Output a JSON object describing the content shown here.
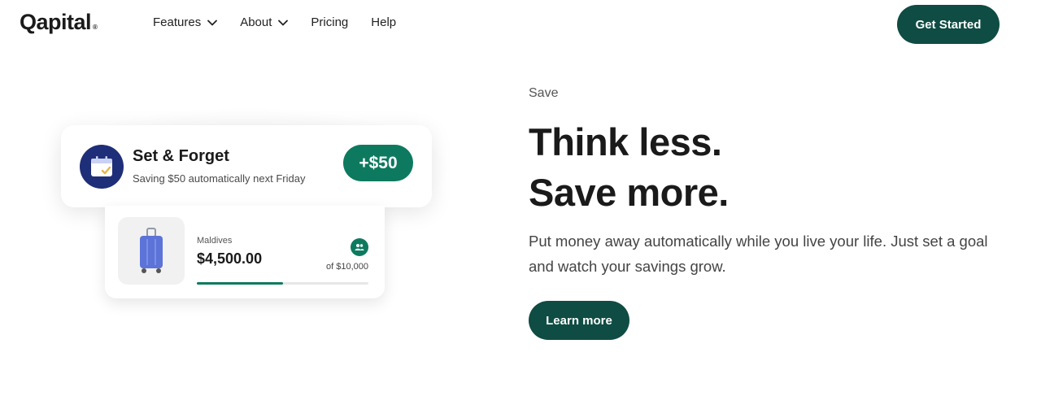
{
  "brand": {
    "name": "Qapital",
    "mark": "®",
    "accent": "#0f4c43",
    "green": "#0d7a5f"
  },
  "nav": {
    "items": [
      {
        "label": "Features",
        "dropdown": true
      },
      {
        "label": "About",
        "dropdown": true
      },
      {
        "label": "Pricing",
        "dropdown": false
      },
      {
        "label": "Help",
        "dropdown": false
      }
    ],
    "cta_label": "Get Started"
  },
  "illustration": {
    "rule_card": {
      "icon": "calendar-icon",
      "title": "Set & Forget",
      "subtitle": "Saving $50 automatically next Friday",
      "amount": "+$50"
    },
    "goal_card": {
      "icon": "suitcase-icon",
      "name": "Maldives",
      "amount": "$4,500.00",
      "target": "of $10,000",
      "progress": 0.5,
      "shared_icon": "people-icon"
    }
  },
  "hero": {
    "eyebrow": "Save",
    "headline_line1": "Think less.",
    "headline_line2": "Save more.",
    "body": "Put money away automatically while you live your life. Just set a goal and watch your savings grow.",
    "button_label": "Learn more"
  }
}
